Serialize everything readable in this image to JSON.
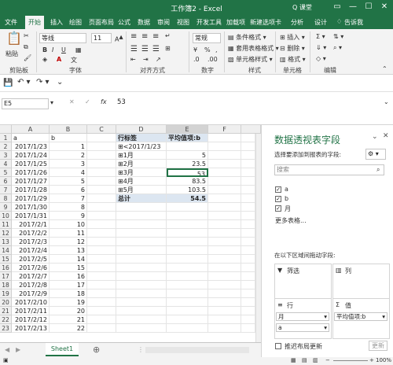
{
  "window": {
    "title": "工作簿2 - Excel",
    "user": "Q 课堂",
    "controls": [
      "▭",
      "—",
      "☐",
      "✕"
    ]
  },
  "tabs": {
    "items": [
      "文件",
      "开始",
      "插入",
      "绘图",
      "页面布局",
      "公式",
      "数据",
      "审阅",
      "视图",
      "开发工具",
      "加载项",
      "新建选项卡",
      "分析",
      "设计"
    ],
    "help": "告诉我"
  },
  "ribbon": {
    "paste": "粘贴",
    "font_name": "等线",
    "font_size": "11",
    "number_format": "常规",
    "conditional_format": "条件格式",
    "table_format": "套用表格格式",
    "cell_style": "单元格样式",
    "insert": "插入",
    "delete": "删除",
    "format": "格式",
    "groups": {
      "clipboard": "剪贴板",
      "font": "字体",
      "align": "对齐方式",
      "number": "数字",
      "styles": "样式",
      "cells": "单元格",
      "editing": "编辑"
    }
  },
  "formula_bar": {
    "name_box": "E5",
    "fx": "fx",
    "value": "53"
  },
  "grid": {
    "columns": [
      "A",
      "B",
      "C",
      "D",
      "E",
      "F"
    ],
    "rows": [
      "1",
      "2",
      "3",
      "4",
      "5",
      "6",
      "7",
      "8",
      "9",
      "10",
      "11",
      "12",
      "13",
      "14",
      "15",
      "16",
      "17",
      "18",
      "19",
      "20",
      "21",
      "22",
      "23"
    ],
    "col_a": [
      "a",
      "2017/1/23",
      "2017/1/24",
      "2017/1/25",
      "2017/1/26",
      "2017/1/27",
      "2017/1/28",
      "2017/1/29",
      "2017/1/30",
      "2017/1/31",
      "2017/2/1",
      "2017/2/2",
      "2017/2/3",
      "2017/2/4",
      "2017/2/5",
      "2017/2/6",
      "2017/2/7",
      "2017/2/8",
      "2017/2/9",
      "2017/2/10",
      "2017/2/11",
      "2017/2/12",
      "2017/2/13"
    ],
    "col_b": [
      "b",
      "1",
      "2",
      "3",
      "4",
      "5",
      "6",
      "7",
      "8",
      "9",
      "10",
      "11",
      "12",
      "13",
      "14",
      "15",
      "16",
      "17",
      "18",
      "19",
      "20",
      "21",
      "22"
    ],
    "pivot": {
      "header_label": "行标签",
      "header_value": "平均值项:b",
      "rows": [
        {
          "label": "<2017/1/23",
          "value": ""
        },
        {
          "label": "1月",
          "value": "5"
        },
        {
          "label": "2月",
          "value": "23.5"
        },
        {
          "label": "3月",
          "value": "53"
        },
        {
          "label": "4月",
          "value": "83.5"
        },
        {
          "label": "5月",
          "value": "103.5"
        }
      ],
      "total_label": "总计",
      "total_value": "54.5"
    }
  },
  "sheets": {
    "active": "Sheet1"
  },
  "status": {
    "zoom": "100%"
  },
  "pane": {
    "title": "数据透视表字段",
    "subtitle": "选择要添加到报表的字段:",
    "search_placeholder": "搜索",
    "fields": [
      "a",
      "b",
      "月"
    ],
    "more_tables": "更多表格...",
    "drag_hint": "在以下区域间拖动字段:",
    "filter": "筛选",
    "columns": "列",
    "rows": "行",
    "values": "值",
    "row_items": [
      "月",
      "a"
    ],
    "value_items": [
      "平均值项:b"
    ],
    "defer_label": "推迟布局更新",
    "update": "更新"
  },
  "colors": {
    "excel_green": "#217346",
    "pivot_header": "#dce6f1",
    "pane_title": "#217346"
  }
}
